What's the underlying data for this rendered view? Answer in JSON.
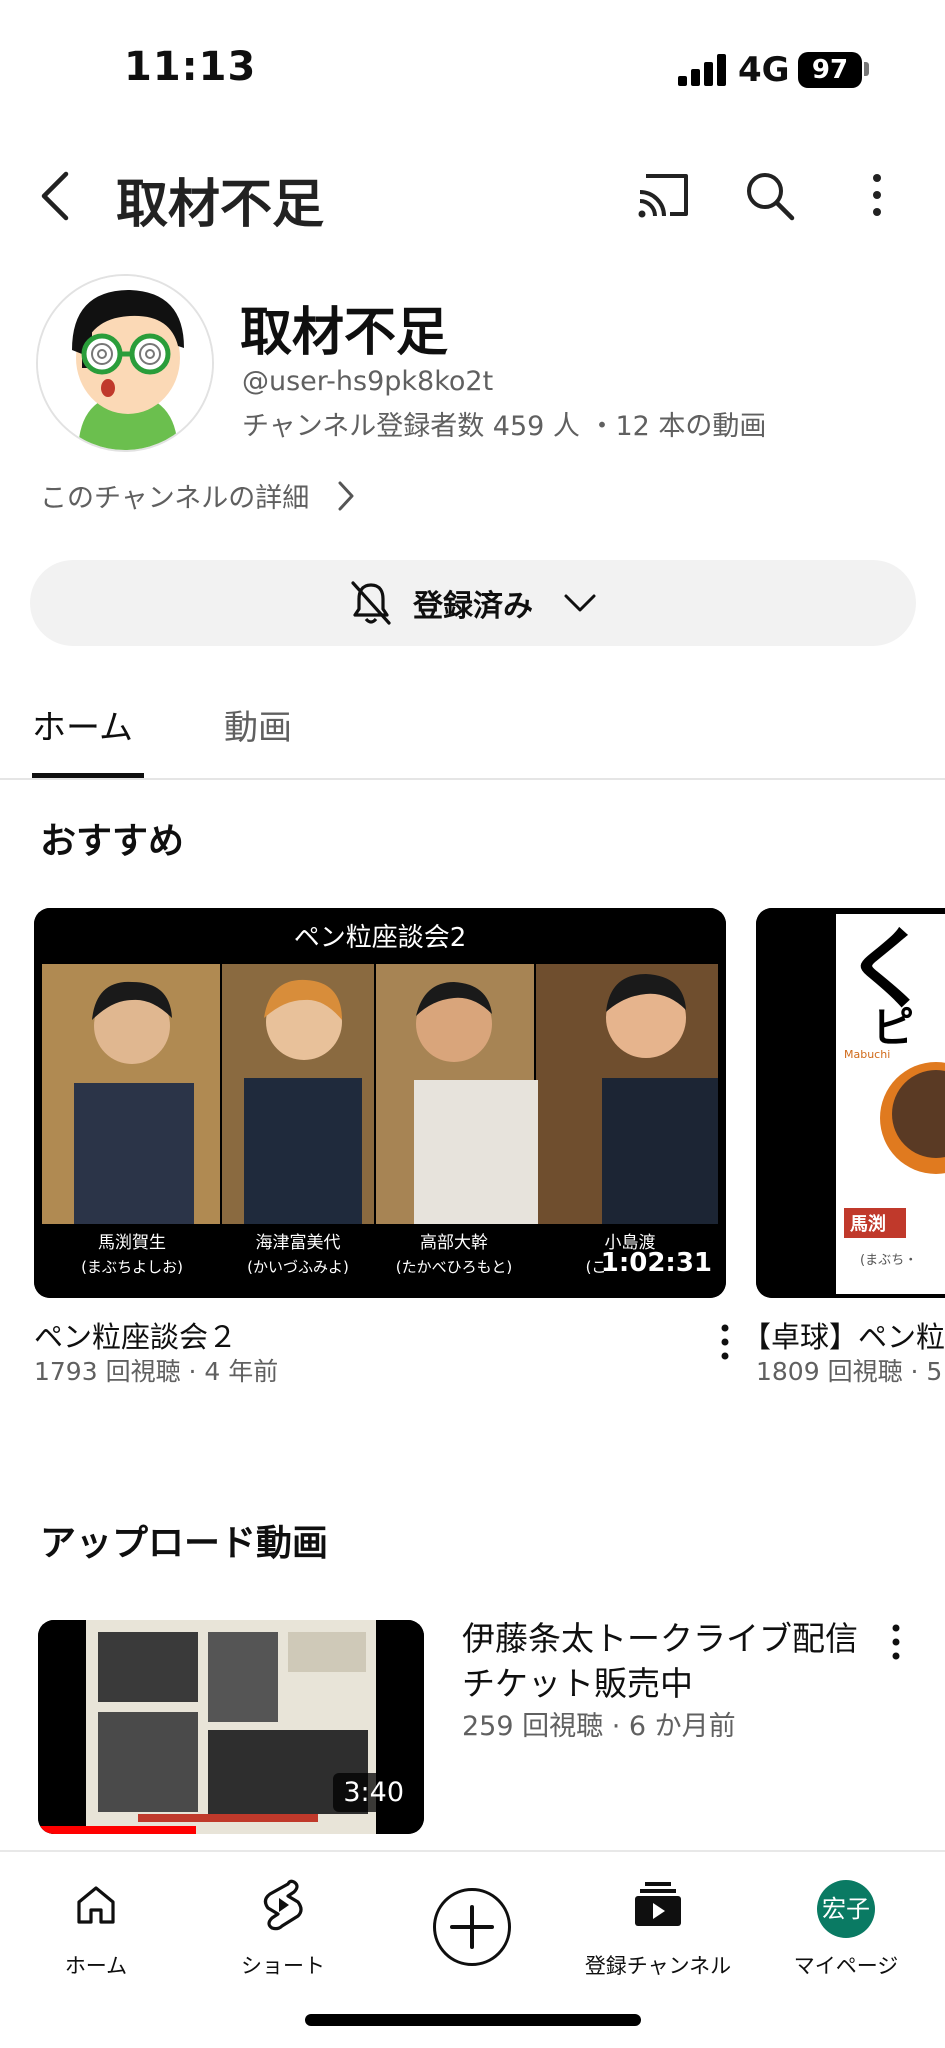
{
  "status_bar": {
    "time": "11:13",
    "network": "4G",
    "battery": "97"
  },
  "app_bar": {
    "title": "取材不足"
  },
  "channel": {
    "name": "取材不足",
    "handle": "@user-hs9pk8ko2t",
    "stats": "チャンネル登録者数 459 人 ・12 本の動画",
    "details_link": "このチャンネルの詳細",
    "subscribe_label": "登録済み"
  },
  "tabs": [
    {
      "label": "ホーム",
      "active": true
    },
    {
      "label": "動画",
      "active": false
    }
  ],
  "recommended": {
    "title": "おすすめ",
    "items": [
      {
        "thumb_banner": "ペン粒座談会2",
        "captions": [
          {
            "name": "馬渕賀生",
            "reading": "(まぶちよしお)"
          },
          {
            "name": "海津富美代",
            "reading": "(かいづふみよ)"
          },
          {
            "name": "高部大幹",
            "reading": "(たかべひろもと)"
          },
          {
            "name": "小島渡",
            "reading": "(こ"
          }
        ],
        "duration": "1:02:31",
        "title": "ペン粒座談会２",
        "meta": "1793 回視聴 · 4 年前"
      },
      {
        "thumb_text_large": "く",
        "thumb_text_mid": "ピ",
        "thumb_text_small": "Mabuchi",
        "thumb_caption": "馬渕",
        "thumb_reading": "(まぶち・",
        "title": "【卓球】ペン粒",
        "meta": "1809 回視聴 · 5"
      }
    ]
  },
  "uploads": {
    "title": "アップロード動画",
    "items": [
      {
        "title": "伊藤条太トークライブ配信チケット販売中",
        "meta": "259 回視聴 · 6 か月前",
        "duration": "3:40",
        "watched_fraction": 0.41
      }
    ]
  },
  "bottom_nav": [
    {
      "label": "ホーム",
      "icon": "home-icon"
    },
    {
      "label": "ショート",
      "icon": "shorts-icon"
    },
    {
      "label": "",
      "icon": "create-plus-icon"
    },
    {
      "label": "登録チャンネル",
      "icon": "subscriptions-icon"
    },
    {
      "label": "マイページ",
      "icon": "profile-avatar",
      "avatar_text": "宏子"
    }
  ]
}
